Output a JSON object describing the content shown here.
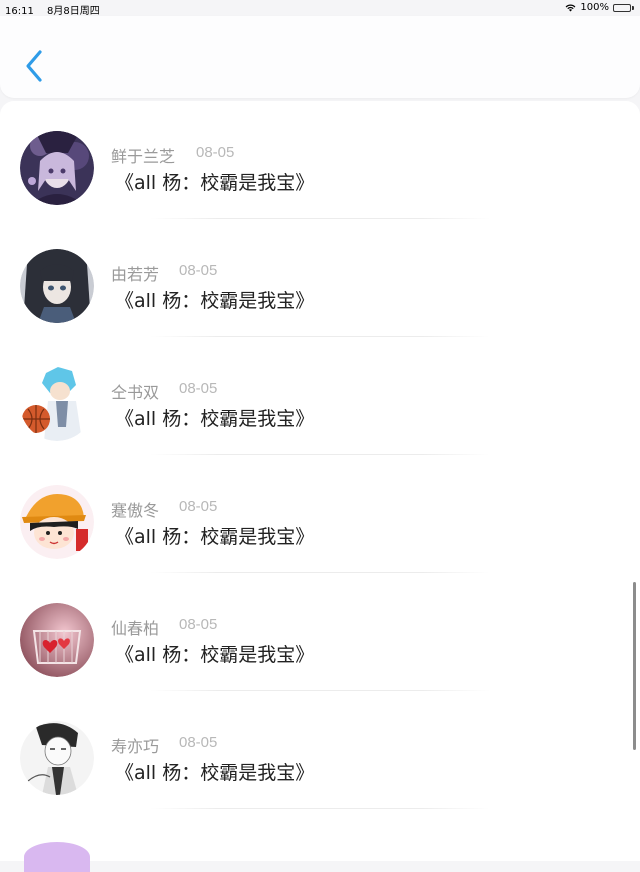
{
  "status_bar": {
    "time": "16:11",
    "date": "8月8日周四",
    "battery": "100%",
    "battery_level": 1.0
  },
  "header": {
    "back_icon": "chevron-left-icon",
    "accent": "#2f9ce8"
  },
  "items": [
    {
      "name": "鲜于兰芝",
      "date": "08-05",
      "title": "《all 杨：校霸是我宝》",
      "avatar_icon": "anime-girl-purple-avatar"
    },
    {
      "name": "由若芳",
      "date": "08-05",
      "title": "《all 杨：校霸是我宝》",
      "avatar_icon": "anime-girl-dark-hair-avatar"
    },
    {
      "name": "仝书双",
      "date": "08-05",
      "title": "《all 杨：校霸是我宝》",
      "avatar_icon": "basketball-boy-avatar"
    },
    {
      "name": "蹇傲冬",
      "date": "08-05",
      "title": "《all 杨：校霸是我宝》",
      "avatar_icon": "cartoon-girl-hat-avatar"
    },
    {
      "name": "仙春柏",
      "date": "08-05",
      "title": "《all 杨：校霸是我宝》",
      "avatar_icon": "red-hearts-avatar"
    },
    {
      "name": "寿亦巧",
      "date": "08-05",
      "title": "《all 杨：校霸是我宝》",
      "avatar_icon": "sketch-boy-avatar"
    }
  ]
}
